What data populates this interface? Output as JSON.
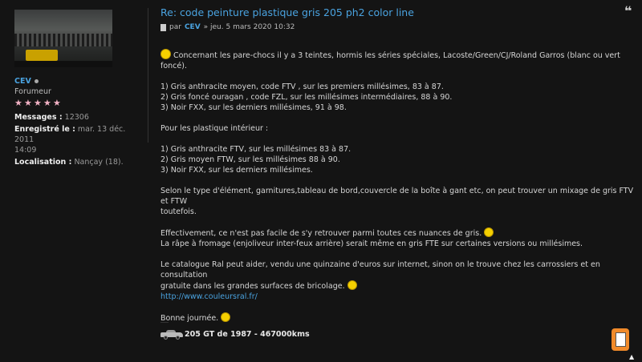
{
  "profile": {
    "username": "CEV",
    "rank": "Forumeur",
    "stars": [
      "★",
      "★",
      "★",
      "★",
      "★"
    ],
    "messages_label": "Messages :",
    "messages_value": "12306",
    "registered_label": "Enregistré le :",
    "registered_value_1": "mar. 13 déc. 2011",
    "registered_value_2": "14:09",
    "location_label": "Localisation :",
    "location_value": "Nançay (18)."
  },
  "post": {
    "title": "Re: code peinture plastique gris 205 ph2 color line",
    "by": "par",
    "author": "CEV",
    "date": "» jeu. 5 mars 2020 10:32",
    "quote_glyph": "❝",
    "intro": "Concernant les pare-chocs il y a 3 teintes, hormis les séries spéciales, Lacoste/Green/CJ/Roland Garros (blanc ou vert foncé).",
    "list1": [
      "1) Gris anthracite moyen, code FTV , sur les premiers millésimes, 83 à 87.",
      "2) Gris foncé ouragan , code FZL, sur les millésimes intermédiaires, 88 à 90.",
      "3) Noir FXX, sur les derniers millésimes, 91 à 98."
    ],
    "interior_heading": "Pour les plastique intérieur :",
    "list2": [
      "1) Gris anthracite FTV, sur les millésimes 83 à 87.",
      "2) Gris moyen FTW, sur les millésimes 88 à 90.",
      "3) Noir FXX, sur les derniers millésimes."
    ],
    "para_mix_1": "Selon le type d'élément, garnitures,tableau de bord,couvercle de la boîte à gant etc, on peut trouver un mixage de gris FTV et FTW",
    "para_mix_2": "toutefois.",
    "para_eff_1": "Effectivement, ce n'est pas facile de s'y retrouver parmi toutes ces nuances de gris.",
    "para_eff_2": "La râpe à fromage (enjoliveur inter-feux arrière) serait même en gris FTE sur certaines versions ou millésimes.",
    "para_ral_1": "Le catalogue Ral peut aider, vendu une quinzaine d'euros sur internet, sinon on le trouve chez les carrossiers et en consultation",
    "para_ral_2": "gratuite dans les grandes surfaces de bricolage.",
    "link": "http://www.couleursral.fr/",
    "closing": "Bonne journée."
  },
  "signature": {
    "text": "205 GT de 1987 - 467000kms"
  },
  "controls": {
    "up_arrow": "▲"
  },
  "colors": {
    "background": "#141414",
    "accent": "#4aa3e0",
    "clip_button": "#f08a2a"
  }
}
